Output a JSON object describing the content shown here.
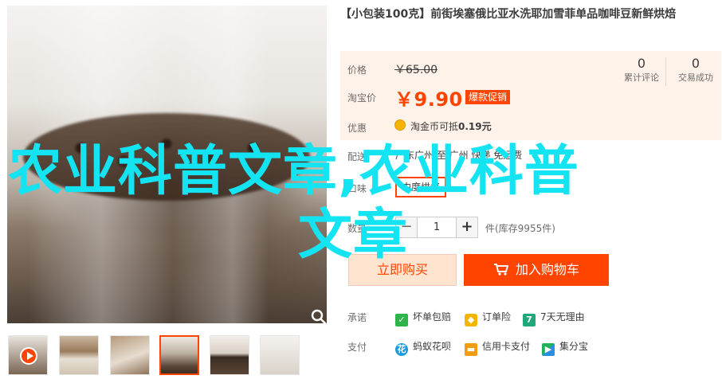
{
  "product": {
    "title": "【小包装100克】前街埃塞俄比亚水洗耶加雪菲单品咖啡豆新鲜烘焙",
    "price_label": "价格",
    "original_price": "￥65.00",
    "promo_label": "淘宝价",
    "promo_price": "￥9.90",
    "promo_tag": "爆款促销",
    "reviews_count": "0",
    "reviews_label": "累计评论",
    "sales_count": "0",
    "sales_label": "交易成功",
    "coupon_label": "优惠",
    "coupon_text": "淘金币可抵",
    "coupon_value": "0.19元"
  },
  "shipping": {
    "label": "配送",
    "text": "广东广州 至 广州 快递 免运费"
  },
  "flavor": {
    "label": "口味",
    "option": "中度烘焙"
  },
  "quantity": {
    "label": "数量",
    "minus": "−",
    "value": "1",
    "plus": "+",
    "stock": "件(库存9955件)"
  },
  "actions": {
    "buy_now": "立即购买",
    "add_cart": "加入购物车"
  },
  "promise": {
    "label": "承诺",
    "items": [
      "坏单包赔",
      "订单险",
      "7天无理由"
    ]
  },
  "payment": {
    "label": "支付",
    "items": [
      "蚂蚁花呗",
      "信用卡支付",
      "集分宝"
    ]
  },
  "watermark": {
    "line1": "农业科普文章,农业科普",
    "line2": "文章"
  },
  "colors": {
    "accent": "#ff4400",
    "panel": "#fff2e8",
    "watermark": "#14e3f2"
  }
}
